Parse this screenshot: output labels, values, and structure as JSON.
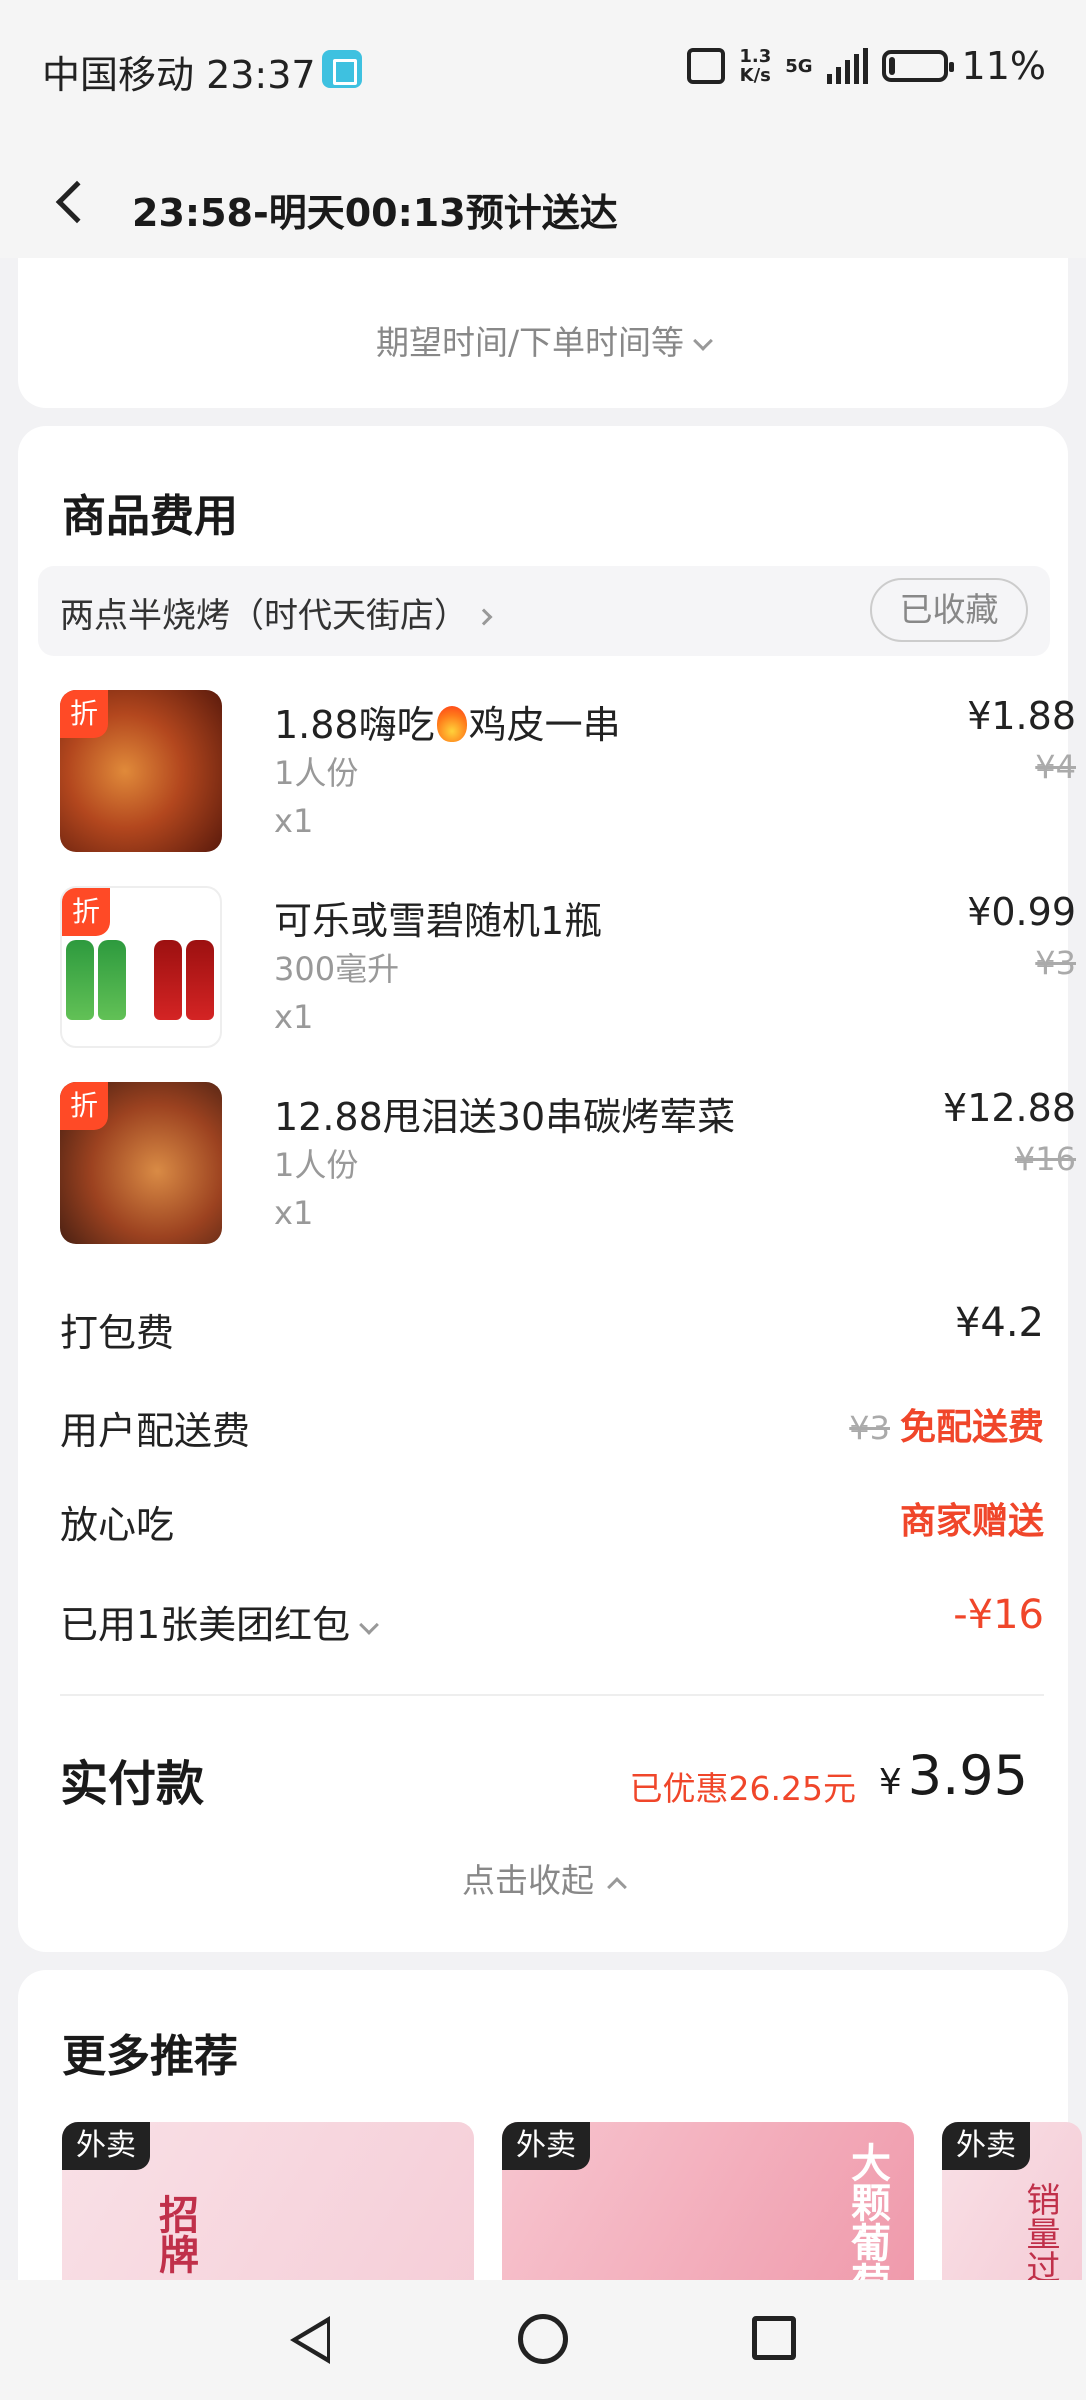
{
  "status_bar": {
    "carrier_time": "中国移动 23:37",
    "net_speed_top": "1.3",
    "net_speed_bottom": "K/s",
    "network": "5G",
    "battery": "11%",
    "battery_level": 0.11
  },
  "header": {
    "title": "23:58-明天00:13预计送达"
  },
  "delivery": {
    "hint": "期望时间/下单时间等"
  },
  "goods": {
    "section_title": "商品费用",
    "store_name": "两点半烧烤（时代天街店）",
    "fav_label": "已收藏",
    "items": [
      {
        "tag": "折",
        "name_a": "1.88嗨吃",
        "name_b": "鸡皮一串",
        "spec": "1人份",
        "qty": "x1",
        "price": "¥1.88",
        "orig": "¥4"
      },
      {
        "tag": "折",
        "name": "可乐或雪碧随机1瓶",
        "spec": "300毫升",
        "qty": "x1",
        "price": "¥0.99",
        "orig": "¥3"
      },
      {
        "tag": "折",
        "name": "12.88甩泪送30串碳烤荤菜",
        "spec": "1人份",
        "qty": "x1",
        "price": "¥12.88",
        "orig": "¥16"
      }
    ]
  },
  "fees": {
    "packing_label": "打包费",
    "packing_value": "¥4.2",
    "delivery_label": "用户配送费",
    "delivery_orig": "¥3",
    "delivery_value": "免配送费",
    "safe_label": "放心吃",
    "safe_value": "商家赠送",
    "coupon_label": "已用1张美团红包",
    "coupon_value": "-¥16"
  },
  "total": {
    "label": "实付款",
    "saved": "已优惠26.25元",
    "currency": "¥",
    "amount": "3.95",
    "collapse": "点击收起"
  },
  "recommend": {
    "title": "更多推荐",
    "cards": [
      {
        "tag": "外卖",
        "text": "招牌"
      },
      {
        "tag": "外卖",
        "text": "大颗葡萄"
      },
      {
        "tag": "外卖",
        "text": "销量过"
      }
    ]
  },
  "colors": {
    "accent_red": "#f0462a",
    "discount_tag": "#ff4a26",
    "background": "#f2f2f4"
  }
}
